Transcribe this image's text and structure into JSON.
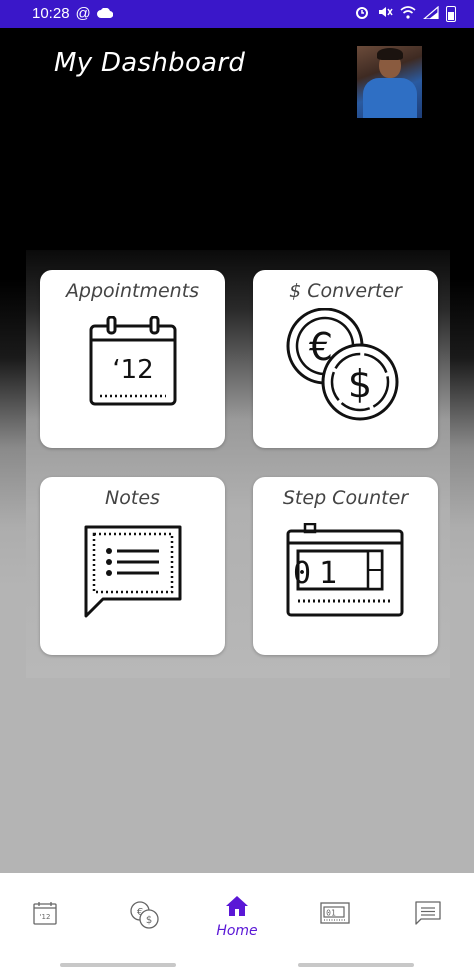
{
  "status_bar": {
    "time": "10:28",
    "at_symbol": "@",
    "cloud_icon": "cloud-icon",
    "right_icons": [
      "alarm-icon",
      "mute-icon",
      "wifi-icon",
      "signal-icon",
      "battery-icon"
    ]
  },
  "header": {
    "title": "My Dashboard",
    "avatar_icon": "user-avatar"
  },
  "cards": [
    {
      "label": "Appointments",
      "icon": "calendar-icon",
      "icon_text": "‘12"
    },
    {
      "label": "$ Converter",
      "icon": "coins-icon",
      "icon_text_1": "€",
      "icon_text_2": "$"
    },
    {
      "label": "Notes",
      "icon": "notes-icon"
    },
    {
      "label": "Step Counter",
      "icon": "counter-icon",
      "icon_text": "01"
    }
  ],
  "bottom_nav": {
    "items": [
      {
        "icon": "calendar-icon",
        "label": ""
      },
      {
        "icon": "coins-icon",
        "label": ""
      },
      {
        "icon": "home-icon",
        "label": "Home",
        "active": true
      },
      {
        "icon": "counter-icon",
        "label": ""
      },
      {
        "icon": "notes-icon",
        "label": ""
      }
    ]
  },
  "colors": {
    "status_bar": "#3a17c9",
    "accent": "#5a17d6",
    "card": "#ffffff"
  }
}
